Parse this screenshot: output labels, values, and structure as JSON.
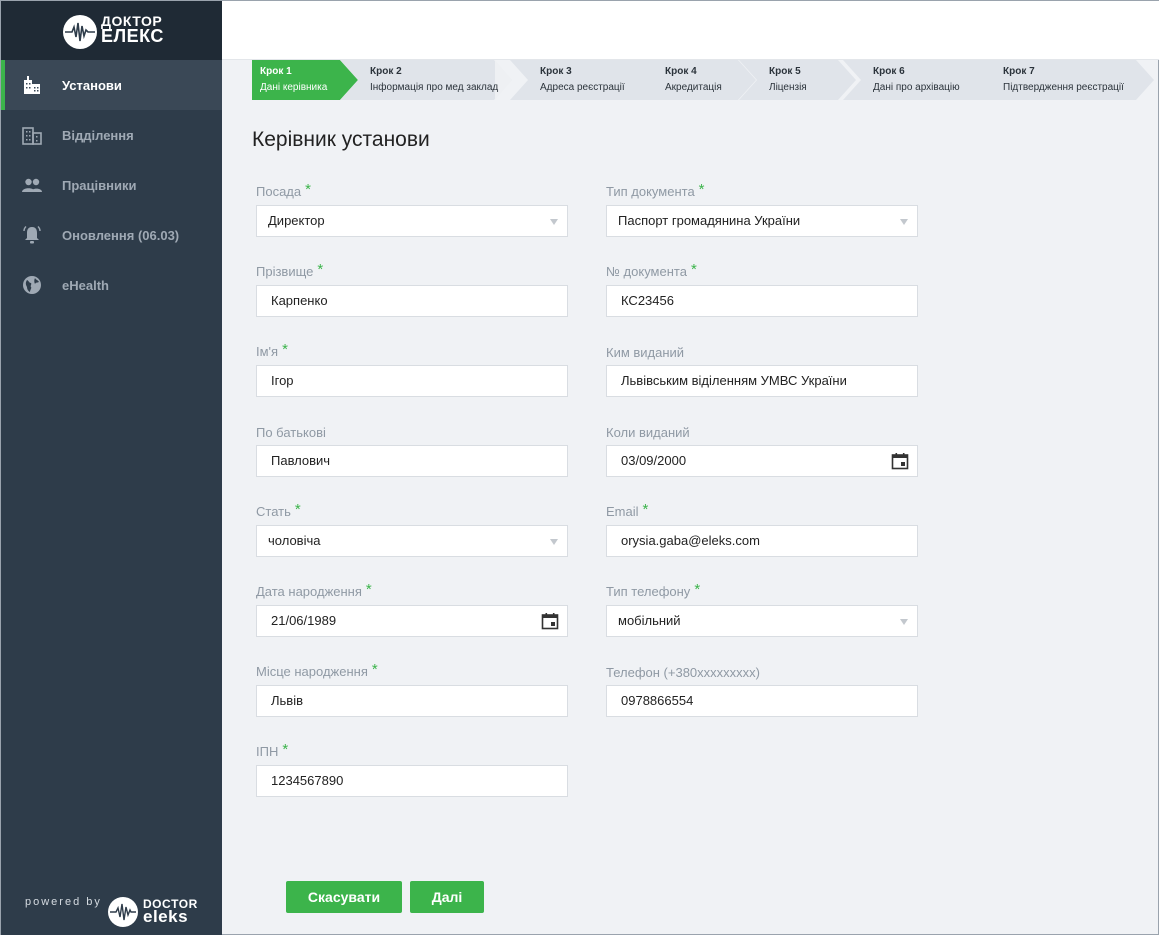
{
  "brand": {
    "line1": "ДОКТОР",
    "line2": "ЕЛЕКС"
  },
  "sidebar": {
    "items": [
      {
        "label": "Установи",
        "icon": "building-icon",
        "active": true
      },
      {
        "label": "Відділення",
        "icon": "departments-icon",
        "active": false
      },
      {
        "label": "Працівники",
        "icon": "people-icon",
        "active": false
      },
      {
        "label": "Оновлення (06.03)",
        "icon": "bell-icon",
        "active": false
      },
      {
        "label": "eHealth",
        "icon": "globe-icon",
        "active": false
      }
    ],
    "powered_by": "powered by",
    "powered_brand_line1": "DOCTOR",
    "powered_brand_line2": "eleks"
  },
  "stepper": [
    {
      "title": "Крок 1",
      "subtitle": "Дані керівника",
      "active": true
    },
    {
      "title": "Крок 2",
      "subtitle": "Інформація про мед заклад",
      "active": false
    },
    {
      "title": "Крок 3",
      "subtitle": "Адреса реєстрації",
      "active": false
    },
    {
      "title": "Крок 4",
      "subtitle": "Акредитація",
      "active": false
    },
    {
      "title": "Крок 5",
      "subtitle": "Ліцензія",
      "active": false
    },
    {
      "title": "Крок 6",
      "subtitle": "Дані про архівацію",
      "active": false
    },
    {
      "title": "Крок 7",
      "subtitle": "Підтвердження реєстрації",
      "active": false
    }
  ],
  "form": {
    "title": "Керівник установи",
    "left": [
      {
        "label": "Посада",
        "required": true,
        "value": "Директор",
        "kind": "select"
      },
      {
        "label": "Прізвище",
        "required": true,
        "value": "Карпенко",
        "kind": "text"
      },
      {
        "label": "Ім'я",
        "required": true,
        "value": "Ігор",
        "kind": "text"
      },
      {
        "label": "По батькові",
        "required": false,
        "value": "Павлович",
        "kind": "text"
      },
      {
        "label": "Стать",
        "required": true,
        "value": "чоловіча",
        "kind": "select"
      },
      {
        "label": "Дата народження",
        "required": true,
        "value": "21/06/1989",
        "kind": "date"
      },
      {
        "label": "Місце народження",
        "required": true,
        "value": "Львів",
        "kind": "text"
      },
      {
        "label": "ІПН",
        "required": true,
        "value": "1234567890",
        "kind": "text"
      }
    ],
    "right": [
      {
        "label": "Тип документа",
        "required": true,
        "value": "Паспорт громадянина України",
        "kind": "select"
      },
      {
        "label": "№ документа",
        "required": true,
        "value": "КС23456",
        "kind": "text"
      },
      {
        "label": "Ким виданий",
        "required": false,
        "value": "Львівським віділенням УМВС України",
        "kind": "text"
      },
      {
        "label": "Коли виданий",
        "required": false,
        "value": "03/09/2000",
        "kind": "date"
      },
      {
        "label": "Email",
        "required": true,
        "value": "orysia.gaba@eleks.com",
        "kind": "text"
      },
      {
        "label": "Тип телефону",
        "required": true,
        "value": "мобільний",
        "kind": "select"
      },
      {
        "label": "Телефон (+380xxxxxxxxx)",
        "required": false,
        "value": "0978866554",
        "kind": "text"
      }
    ],
    "required_mark": "*"
  },
  "actions": {
    "cancel_label": "Скасувати",
    "next_label": "Далі"
  },
  "colors": {
    "accent": "#3cb44b",
    "sidebar": "#2e3c4a",
    "sidebar_dark": "#1f2a35"
  }
}
